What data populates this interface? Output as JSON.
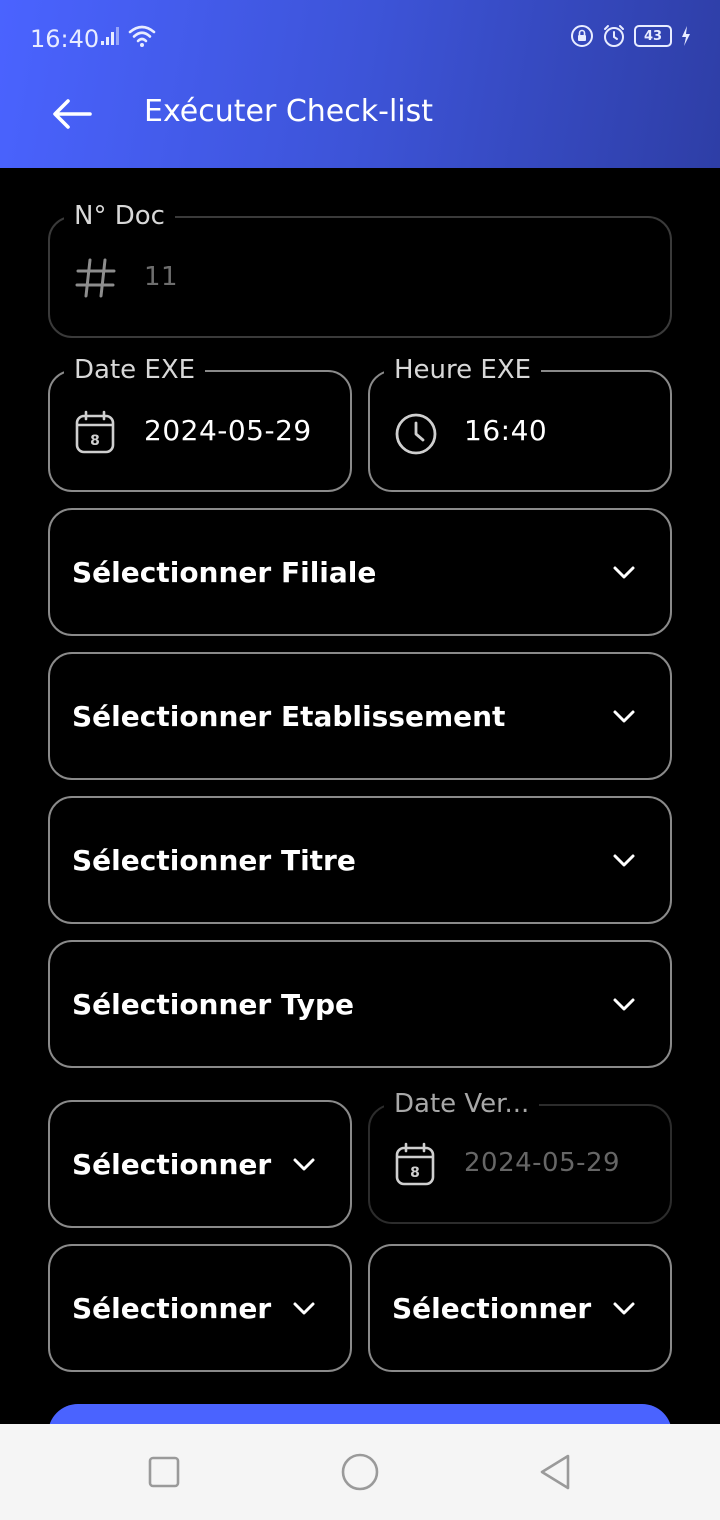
{
  "status": {
    "time": "16:40",
    "battery": "43",
    "icons": [
      "signal-icon",
      "wifi-icon",
      "lock-rotation-icon",
      "alarm-icon",
      "battery-icon",
      "charging-icon"
    ]
  },
  "toolbar": {
    "title": "Exécuter Check-list",
    "back_icon": "arrow-left-icon"
  },
  "form": {
    "doc_no": {
      "label": "N° Doc",
      "value": "11",
      "icon": "hash-icon"
    },
    "date_exe": {
      "label": "Date EXE",
      "value": "2024-05-29",
      "icon": "calendar-icon"
    },
    "heure_exe": {
      "label": "Heure EXE",
      "value": "16:40",
      "icon": "clock-icon"
    },
    "filiale": {
      "label": "Sélectionner Filiale"
    },
    "etablissement": {
      "label": "Sélectionner Etablissement"
    },
    "titre": {
      "label": "Sélectionner Titre"
    },
    "type": {
      "label": "Sélectionner Type"
    },
    "select_a": {
      "label": "Sélectionner"
    },
    "date_ver": {
      "label": "Date Ver...",
      "value": "2024-05-29",
      "icon": "calendar-icon"
    },
    "select_b": {
      "label": "Sélectionner"
    },
    "select_c": {
      "label": "Sélectionner"
    }
  },
  "colors": {
    "accent": "#4a63ff",
    "header_gradient_end": "#2e3ea6",
    "background": "#000000",
    "field_border": "#8a8a8a"
  },
  "navbar": {
    "icons": [
      "recent-apps-icon",
      "home-icon",
      "back-icon"
    ]
  }
}
